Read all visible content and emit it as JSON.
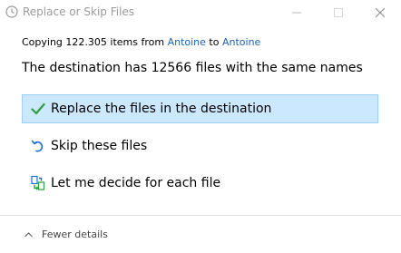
{
  "window": {
    "title": "Replace or Skip Files",
    "icon": "clock-icon"
  },
  "controls": {
    "minimize_icon": "minimize-icon",
    "maximize_icon": "maximize-icon",
    "close_icon": "close-icon"
  },
  "status": {
    "prefix": "Copying 122.305 items from ",
    "source": "Antoine",
    "middle": " to ",
    "destination": "Antoine"
  },
  "heading": "The destination has 12566 files with the same names",
  "options": [
    {
      "icon": "checkmark-icon",
      "label": "Replace the files in the destination",
      "selected": true
    },
    {
      "icon": "skip-arrow-icon",
      "label": "Skip these files",
      "selected": false
    },
    {
      "icon": "compare-files-icon",
      "label": "Let me decide for each file",
      "selected": false
    }
  ],
  "footer": {
    "details_label": "Fewer details",
    "details_icon": "chevron-up-icon"
  },
  "colors": {
    "link": "#1a62b7",
    "selection_bg": "#cce8ff",
    "selection_border": "#99d1ff",
    "check_green": "#2e9e3f",
    "skip_blue": "#1a6fd1"
  }
}
